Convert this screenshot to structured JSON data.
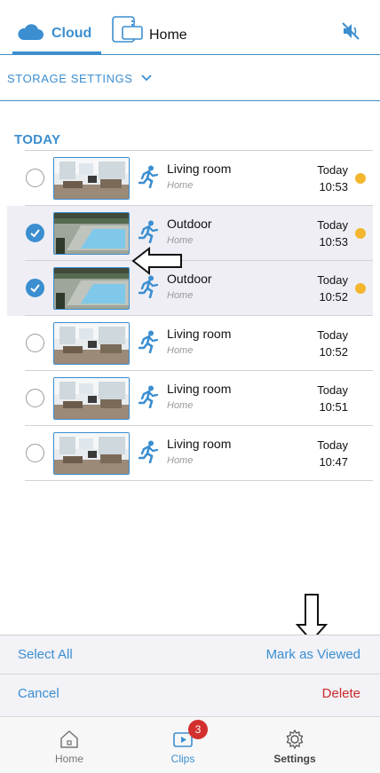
{
  "header": {
    "tabs": [
      {
        "label": "Cloud",
        "icon": "cloud-icon",
        "active": true
      },
      {
        "label": "Home",
        "icon": "home-device-icon",
        "active": false
      }
    ],
    "mute_icon": "speaker-muted-icon",
    "accent": "#3b8ed0"
  },
  "storage": {
    "label": "STORAGE SETTINGS",
    "icon": "chevron-down-icon"
  },
  "section": {
    "title": "TODAY"
  },
  "clips": [
    {
      "title": "Living room",
      "location": "Home",
      "day": "Today",
      "time": "10:53",
      "checked": false,
      "new": true,
      "camera": "living"
    },
    {
      "title": "Outdoor",
      "location": "Home",
      "day": "Today",
      "time": "10:53",
      "checked": true,
      "new": true,
      "camera": "outdoor"
    },
    {
      "title": "Outdoor",
      "location": "Home",
      "day": "Today",
      "time": "10:52",
      "checked": true,
      "new": true,
      "camera": "outdoor"
    },
    {
      "title": "Living room",
      "location": "Home",
      "day": "Today",
      "time": "10:52",
      "checked": false,
      "new": false,
      "camera": "living"
    },
    {
      "title": "Living room",
      "location": "Home",
      "day": "Today",
      "time": "10:51",
      "checked": false,
      "new": false,
      "camera": "living"
    },
    {
      "title": "Living room",
      "location": "Home",
      "day": "Today",
      "time": "10:47",
      "checked": false,
      "new": false,
      "camera": "living"
    }
  ],
  "actions": {
    "select_all": "Select All",
    "mark_viewed": "Mark as Viewed",
    "cancel": "Cancel",
    "delete": "Delete"
  },
  "nav": {
    "items": [
      {
        "label": "Home",
        "icon": "home-icon"
      },
      {
        "label": "Clips",
        "icon": "play-icon",
        "badge": "3"
      },
      {
        "label": "Settings",
        "icon": "gear-icon"
      }
    ]
  },
  "colors": {
    "new_dot": "#f3b62e",
    "delete": "#cc2a2a",
    "badge": "#d32f2f"
  }
}
